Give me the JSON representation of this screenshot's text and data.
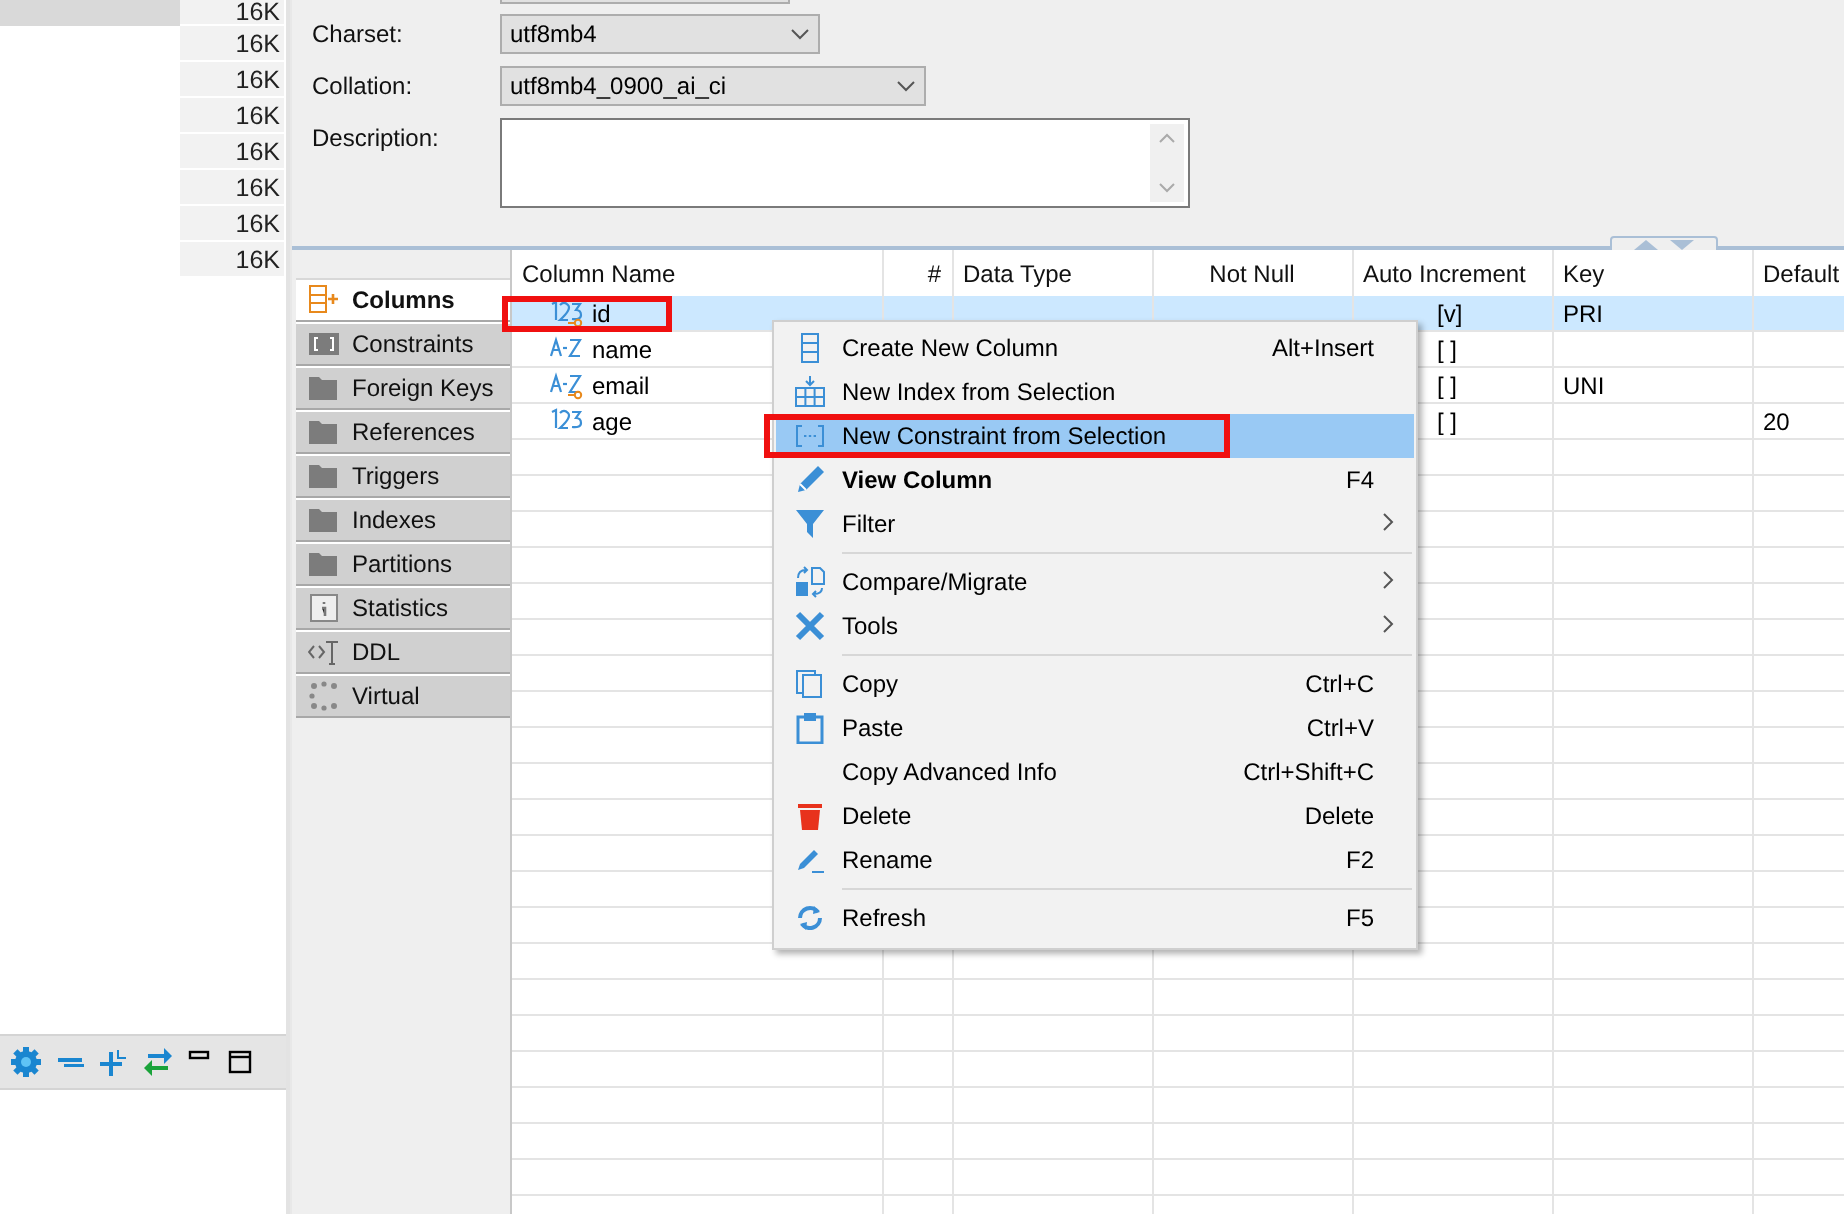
{
  "file_list": {
    "rows": [
      {
        "size": "16K",
        "selected": true
      },
      {
        "size": "16K",
        "selected": false
      },
      {
        "size": "16K",
        "selected": false
      },
      {
        "size": "16K",
        "selected": false
      },
      {
        "size": "16K",
        "selected": false
      },
      {
        "size": "16K",
        "selected": false
      },
      {
        "size": "16K",
        "selected": false
      },
      {
        "size": "16K",
        "selected": false
      }
    ]
  },
  "properties": {
    "fields": [
      {
        "kind": "combo",
        "label": "Charset:",
        "value": "utf8mb4"
      },
      {
        "kind": "combo",
        "label": "Collation:",
        "value": "utf8mb4_0900_ai_ci"
      },
      {
        "kind": "textarea",
        "label": "Description:"
      }
    ]
  },
  "tabs": [
    {
      "label": "Columns",
      "selected": true
    },
    {
      "label": "Constraints",
      "selected": false
    },
    {
      "label": "Foreign Keys",
      "selected": false
    },
    {
      "label": "References",
      "selected": false
    },
    {
      "label": "Triggers",
      "selected": false
    },
    {
      "label": "Indexes",
      "selected": false
    },
    {
      "label": "Partitions",
      "selected": false
    },
    {
      "label": "Statistics",
      "selected": false
    },
    {
      "label": "DDL",
      "selected": false
    },
    {
      "label": "Virtual",
      "selected": false
    }
  ],
  "table": {
    "columns": [
      "Column Name",
      "#",
      "Data Type",
      "Not Null",
      "Auto Increment",
      "Key",
      "Default"
    ],
    "rows": [
      {
        "selected": true,
        "highlighted": true,
        "cells": [
          "id",
          null,
          null,
          null,
          "[v]",
          "PRI",
          null
        ]
      },
      {
        "selected": false,
        "highlighted": false,
        "cells": [
          "name",
          null,
          null,
          null,
          "[ ]",
          null,
          null
        ]
      },
      {
        "selected": false,
        "highlighted": false,
        "cells": [
          "email",
          null,
          null,
          null,
          "[ ]",
          "UNI",
          null
        ]
      },
      {
        "selected": false,
        "highlighted": false,
        "cells": [
          "age",
          null,
          null,
          null,
          "[ ]",
          null,
          "20"
        ]
      }
    ]
  },
  "context_menu": {
    "items": [
      {
        "kind": "item",
        "label": "Create New Column",
        "shortcut": "Alt+Insert",
        "selected": false,
        "highlighted": false,
        "bold": false,
        "submenu": false
      },
      {
        "kind": "item",
        "label": "New Index from Selection",
        "selected": false,
        "highlighted": false,
        "bold": false,
        "submenu": false
      },
      {
        "kind": "item",
        "label": "New Constraint from Selection",
        "selected": true,
        "highlighted": true,
        "bold": false,
        "submenu": false
      },
      {
        "kind": "item",
        "label": "View Column",
        "shortcut": "F4",
        "selected": false,
        "highlighted": false,
        "bold": true,
        "submenu": false
      },
      {
        "kind": "item",
        "label": "Filter",
        "selected": false,
        "highlighted": false,
        "bold": false,
        "submenu": true
      },
      {
        "kind": "separator"
      },
      {
        "kind": "item",
        "label": "Compare/Migrate",
        "selected": false,
        "highlighted": false,
        "bold": false,
        "submenu": true
      },
      {
        "kind": "item",
        "label": "Tools",
        "selected": false,
        "highlighted": false,
        "bold": false,
        "submenu": true
      },
      {
        "kind": "separator"
      },
      {
        "kind": "item",
        "label": "Copy",
        "shortcut": "Ctrl+C",
        "selected": false,
        "highlighted": false,
        "bold": false,
        "submenu": false
      },
      {
        "kind": "item",
        "label": "Paste",
        "shortcut": "Ctrl+V",
        "selected": false,
        "highlighted": false,
        "bold": false,
        "submenu": false
      },
      {
        "kind": "item",
        "label": "Copy Advanced Info",
        "shortcut": "Ctrl+Shift+C",
        "selected": false,
        "highlighted": false,
        "bold": false,
        "submenu": false
      },
      {
        "kind": "item",
        "label": "Delete",
        "shortcut": "Delete",
        "selected": false,
        "highlighted": false,
        "bold": false,
        "submenu": false
      },
      {
        "kind": "item",
        "label": "Rename",
        "shortcut": "F2",
        "selected": false,
        "highlighted": false,
        "bold": false,
        "submenu": false
      },
      {
        "kind": "separator"
      },
      {
        "kind": "item",
        "label": "Refresh",
        "shortcut": "F5",
        "selected": false,
        "highlighted": false,
        "bold": false,
        "submenu": false
      }
    ]
  }
}
